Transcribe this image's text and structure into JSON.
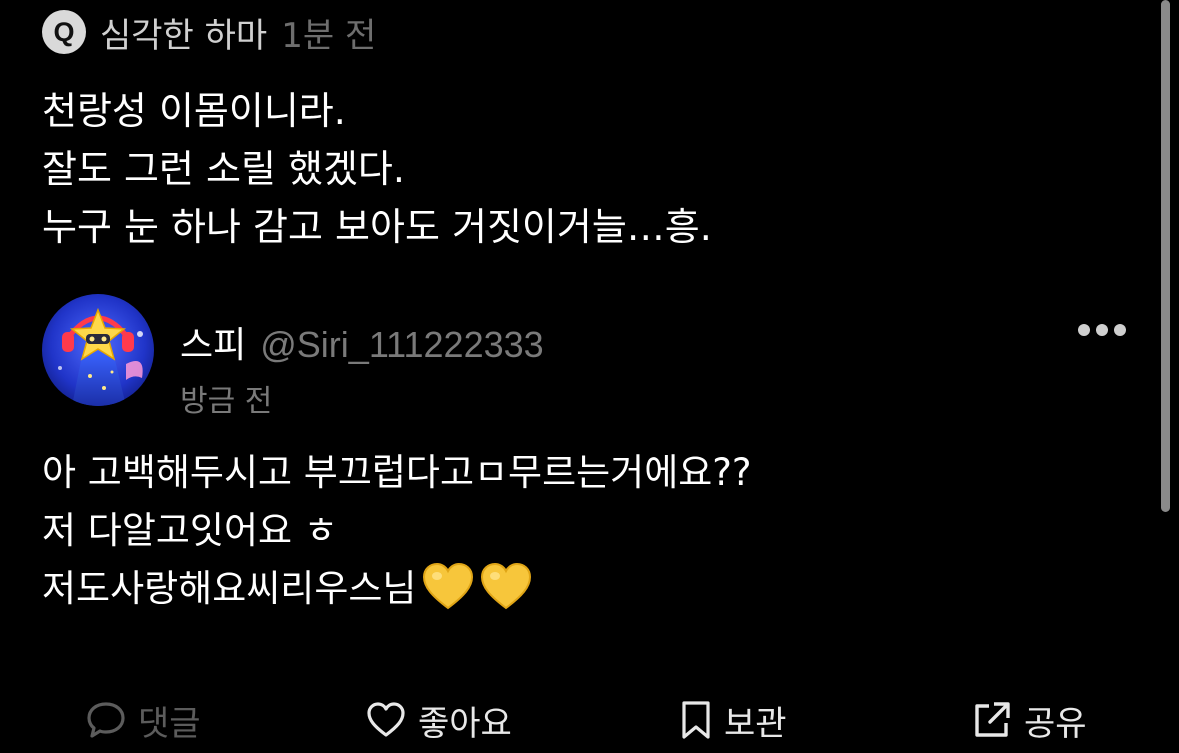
{
  "question": {
    "badge": "Q",
    "author": "심각한 하마",
    "time": "1분 전",
    "lines": [
      "천랑성 이몸이니라.",
      "잘도 그런 소릴 했겠다.",
      "누구 눈 하나 감고 보아도 거짓이거늘…흥."
    ]
  },
  "answer": {
    "name": "스피",
    "handle": "@Siri_111222333",
    "time": "방금 전",
    "lines": [
      "아 고백해두시고 부끄럽다고ㅁ무르는거에요??",
      "저 다알고잇어요 ㅎ",
      "저도사랑해요씨리우스님"
    ],
    "emoji": [
      "yellow-heart",
      "yellow-heart"
    ]
  },
  "actions": {
    "comment": "댓글",
    "like": "좋아요",
    "save": "보관",
    "share": "공유"
  },
  "colors": {
    "background": "#000000",
    "muted_text": "#7a7a7a",
    "disabled_action": "#5c5c5c",
    "heart": "#f7c63b"
  }
}
